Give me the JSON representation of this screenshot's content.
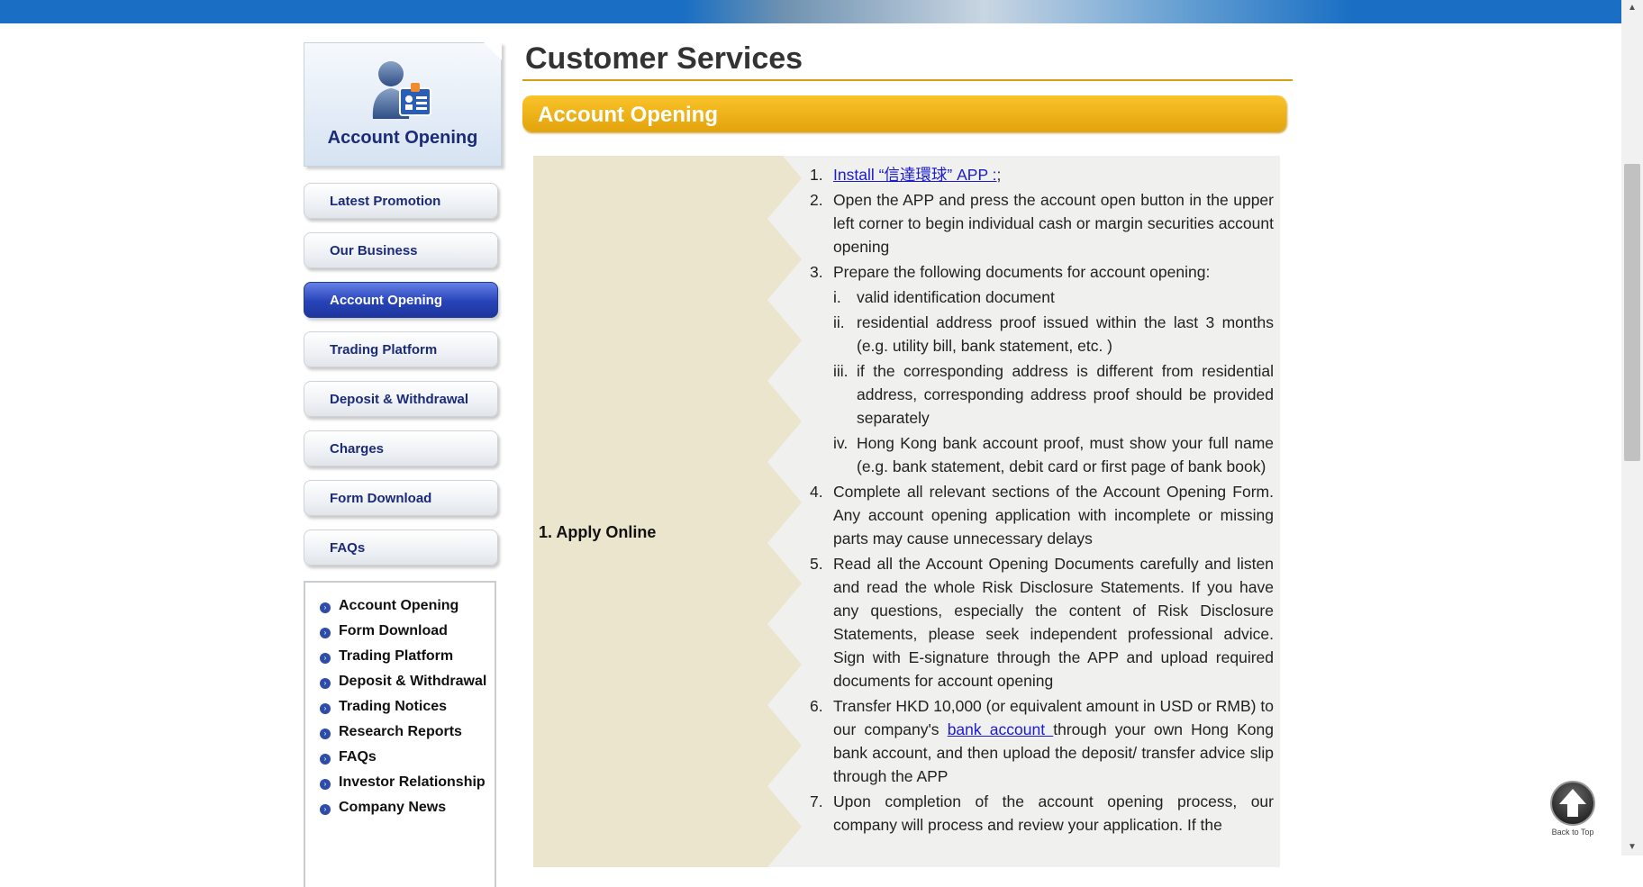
{
  "page": {
    "title": "Customer Services",
    "section_banner": "Account Opening"
  },
  "sidebar": {
    "hero_title": "Account Opening",
    "nav": [
      {
        "label": "Latest Promotion",
        "active": false
      },
      {
        "label": "Our Business",
        "active": false
      },
      {
        "label": "Account Opening",
        "active": true
      },
      {
        "label": "Trading Platform",
        "active": false
      },
      {
        "label": "Deposit & Withdrawal",
        "active": false
      },
      {
        "label": "Charges",
        "active": false
      },
      {
        "label": "Form Download",
        "active": false
      },
      {
        "label": "FAQs",
        "active": false
      }
    ],
    "links": [
      "Account Opening",
      "Form Download",
      "Trading Platform",
      "Deposit & Withdrawal",
      "Trading Notices",
      "Research Reports",
      "FAQs",
      "Investor Relationship",
      "Company News"
    ]
  },
  "table": {
    "step_label": "1. Apply Online",
    "items": {
      "i1": {
        "num": "1.",
        "link": "Install “信達環球” APP :",
        "tail": ";"
      },
      "i2": {
        "num": "2.",
        "text": "Open the APP and press the account open button in the upper left corner to begin individual cash or margin securities account opening"
      },
      "i3": {
        "num": "3.",
        "text": "Prepare the following documents for account opening:"
      },
      "s1": {
        "num": "i.",
        "text": "valid identification document"
      },
      "s2": {
        "num": "ii.",
        "text": "residential address proof issued within the last 3 months (e.g. utility bill, bank statement, etc. )"
      },
      "s3": {
        "num": "iii.",
        "text": "if the corresponding address is different from residential address, corresponding address proof should be provided separately"
      },
      "s4": {
        "num": "iv.",
        "text": "Hong Kong bank account proof, must show your full name (e.g. bank statement, debit card or first page of bank book)"
      },
      "i4": {
        "num": "4.",
        "text": "Complete all relevant sections of the Account Opening Form. Any account opening application with incomplete or missing parts may cause unnecessary delays"
      },
      "i5": {
        "num": "5.",
        "text": "Read all the Account Opening Documents carefully and listen and read the whole Risk Disclosure Statements. If you have any questions, especially the content of Risk Disclosure Statements, please seek independent professional advice. Sign with E-signature through the APP and upload required documents for account opening"
      },
      "i6": {
        "num": "6.",
        "pre": "Transfer HKD 10,000 (or equivalent amount in USD or RMB) to our company's ",
        "link": "bank account ",
        "post": "through your own Hong Kong bank account, and then upload the deposit/ transfer advice slip through the APP"
      },
      "i7": {
        "num": "7.",
        "text": "Upon completion of the account opening process, our company will process and review your application. If the"
      }
    }
  },
  "back_to_top": "Back to Top",
  "colors": {
    "accent_blue": "#1a6fc4",
    "banner_gold": "#f0b31a",
    "nav_active": "#2743b8",
    "link": "#1b1bd0"
  },
  "icons": {
    "hero": "user-id-card-icon",
    "bullet": "chevron-right-circle-icon",
    "back_to_top": "arrow-up-icon"
  }
}
